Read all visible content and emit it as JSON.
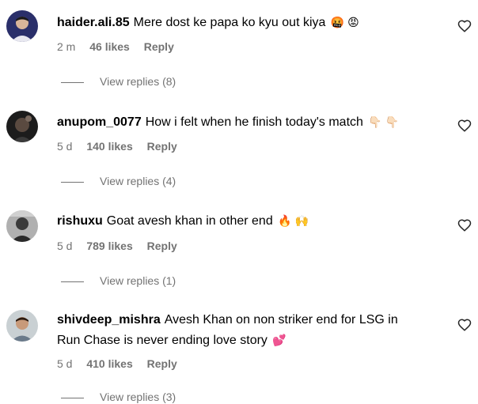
{
  "comments": [
    {
      "username": "haider.ali.85",
      "text": "Mere dost ke papa ko kyu out kiya",
      "emoji": "🤬 😡",
      "time": "2 m",
      "likes": "46 likes",
      "reply_label": "Reply",
      "view_replies": "View replies (8)",
      "avatar_bg": "#2a2f6a"
    },
    {
      "username": "anupom_0077",
      "text": "How i felt when he finish today's match",
      "emoji": "👇🏻 👇🏻",
      "time": "5 d",
      "likes": "140 likes",
      "reply_label": "Reply",
      "view_replies": "View replies (4)",
      "avatar_bg": "#1c1c1c"
    },
    {
      "username": "rishuxu",
      "text": "Goat avesh khan in other end",
      "emoji": "🔥 🙌",
      "time": "5 d",
      "likes": "789 likes",
      "reply_label": "Reply",
      "view_replies": "View replies (1)",
      "avatar_bg": "#8a8a8a"
    },
    {
      "username": "shivdeep_mishra",
      "text": "Avesh Khan on non striker end for LSG in",
      "text_line2": "Run Chase is never ending love story",
      "emoji": "💕",
      "time": "5 d",
      "likes": "410 likes",
      "reply_label": "Reply",
      "view_replies": "View replies (3)",
      "avatar_bg": "#c9d0d3"
    }
  ],
  "colors": {
    "secondary_text": "#737373",
    "primary_text": "#000000",
    "background": "#ffffff"
  },
  "icons": {
    "like": "heart-outline-icon"
  }
}
